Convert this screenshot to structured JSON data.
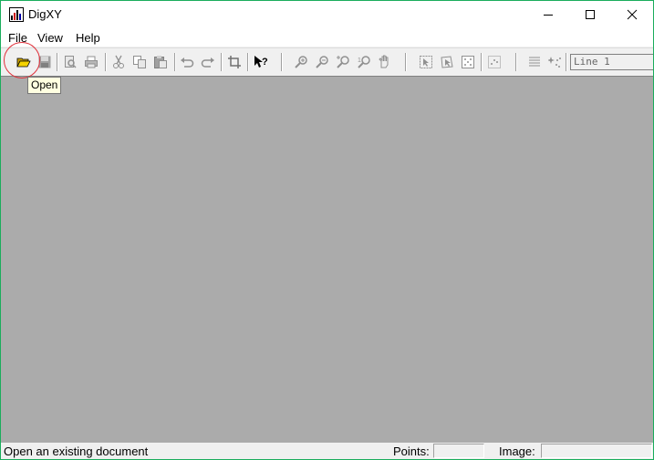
{
  "window": {
    "title": "DigXY"
  },
  "menu": [
    "File",
    "View",
    "Help"
  ],
  "toolbar": {
    "buttons": [
      "open-icon",
      "save-icon",
      "print-preview-icon",
      "print-icon",
      "cut-icon",
      "copy-icon",
      "paste-icon",
      "undo-icon",
      "redo-icon",
      "crop-icon",
      "context-help-icon",
      "zoom-in-icon",
      "zoom-out-icon",
      "zoom-fit-icon",
      "zoom-reset-icon",
      "pan-icon",
      "select-icon",
      "select-point-icon",
      "grid-icon",
      "points-grid-icon",
      "list-icon",
      "sparkle-icon"
    ],
    "line_value": "Line 1"
  },
  "tooltip": "Open",
  "status": {
    "message": "Open an existing document",
    "points_label": "Points:",
    "points_value": "",
    "image_label": "Image:",
    "image_value": ""
  },
  "colors": {
    "workspace": "#ababab",
    "highlight": "#e0303a",
    "tooltip_bg": "#ffffe1",
    "border": "#1aad5c"
  }
}
